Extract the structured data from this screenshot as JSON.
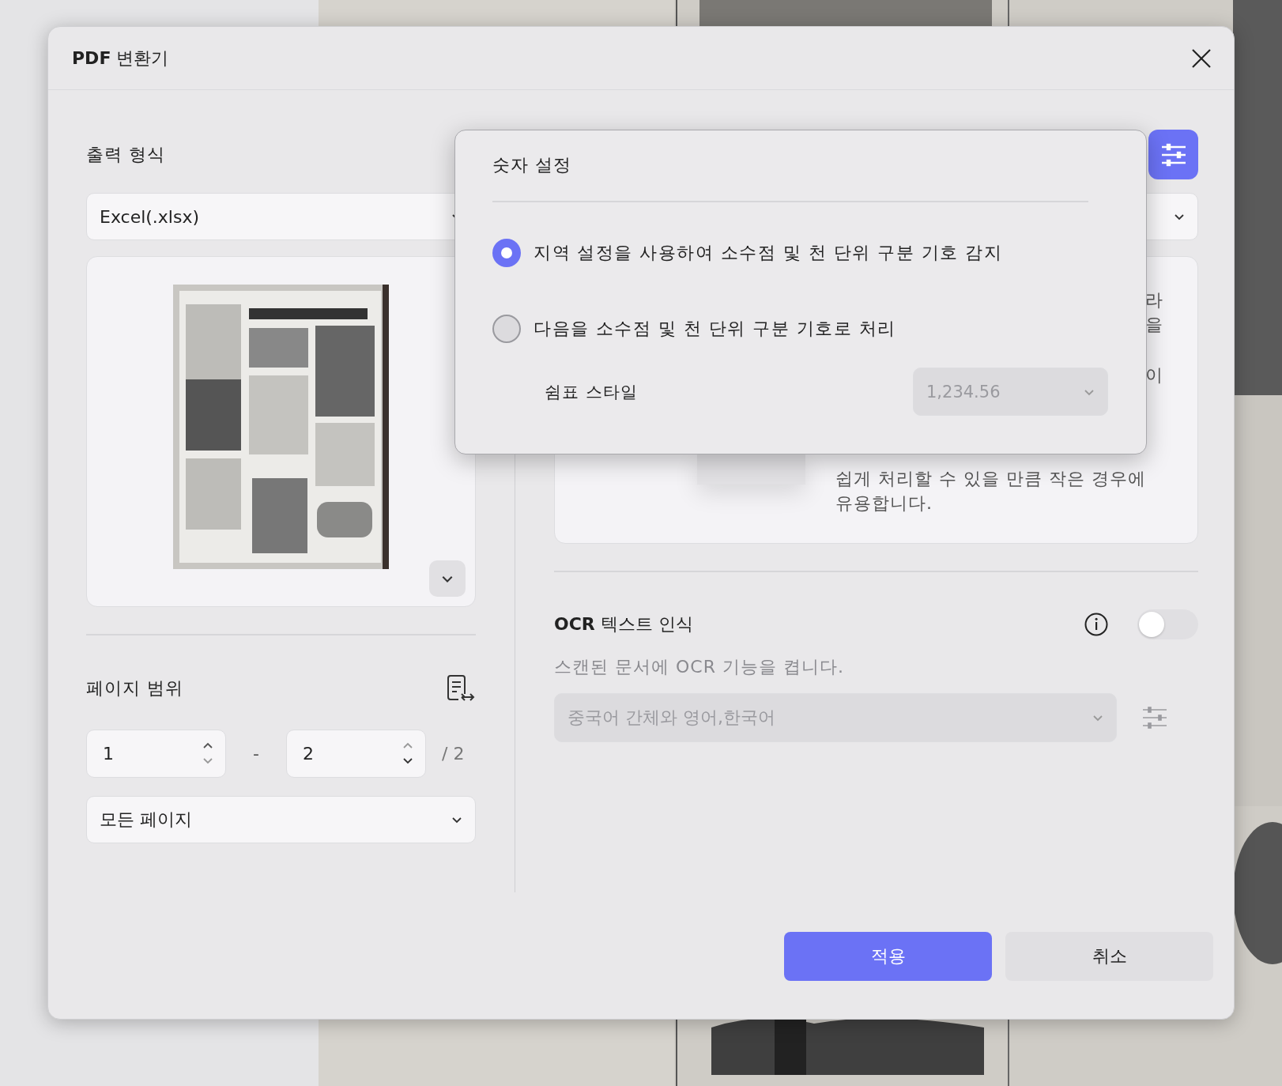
{
  "dialog": {
    "title": "**PDF** 변환기"
  },
  "output_format": {
    "label": "출력 형식",
    "value": "Excel(.xlsx)"
  },
  "page_range": {
    "label": "페이지 범위",
    "from": "1",
    "separator": "-",
    "to": "2",
    "total": "/ 2",
    "pages": "모든 페이지"
  },
  "layout_card": {
    "fragments": [
      "라",
      "을",
      "이"
    ],
    "lines": [
      "쉽게 처리할 수 있을 만큼 작은 경우에",
      "유용합니다."
    ]
  },
  "ocr": {
    "label": "**OCR** 텍스트 인식",
    "on": false,
    "description": "스캔된 문서에 OCR 기능을 켭니다.",
    "languages": {
      "value": "중국어 간체와 영어,한국어",
      "disabled": true
    }
  },
  "buttons": [
    {
      "label": "적용",
      "kind": "primary"
    },
    {
      "label": "취소",
      "kind": "secondary"
    }
  ],
  "number_settings": {
    "title": "숫자 설정",
    "options": [
      {
        "label": "지역 설정을 사용하여 소수점 및 천 단위 구분 기호 감지",
        "selected": true
      },
      {
        "label": "다음을 소수점 및 천 단위 구분 기호로 처리",
        "selected": false
      }
    ],
    "comma_style": {
      "label": "쉼표 스타일",
      "value": "1,234.56",
      "disabled": true
    }
  }
}
